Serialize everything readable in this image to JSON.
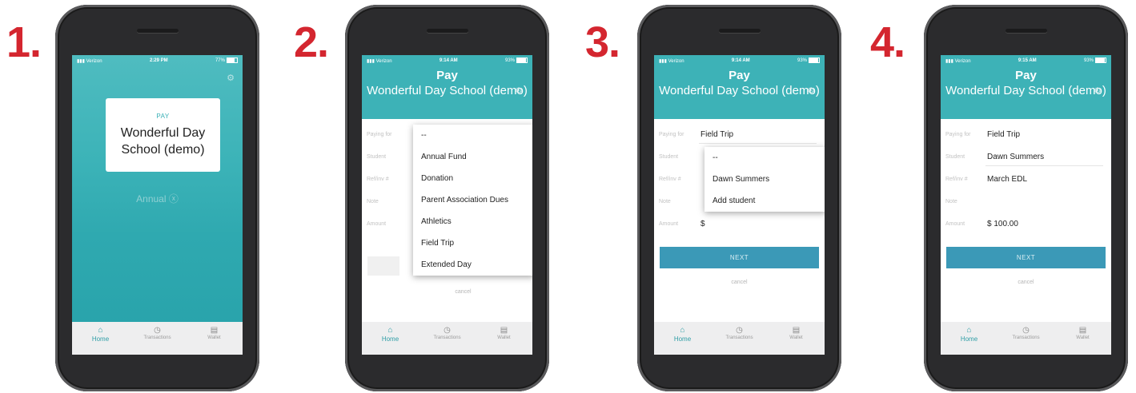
{
  "steps": [
    "1.",
    "2.",
    "3.",
    "4."
  ],
  "colors": {
    "step_number": "#d4262f",
    "teal": "#3db2b7",
    "button": "#3b99b7"
  },
  "status": {
    "s1": {
      "carrier": "Verizon",
      "time": "2:29 PM",
      "battery": "77%"
    },
    "s2": {
      "carrier": "Verizon",
      "time": "9:14 AM",
      "battery": "93%"
    },
    "s3": {
      "carrier": "Verizon",
      "time": "9:14 AM",
      "battery": "93%"
    },
    "s4": {
      "carrier": "Verizon",
      "time": "9:15 AM",
      "battery": "93%"
    }
  },
  "home": {
    "pay_label": "PAY",
    "school_name": "Wonderful Day School (demo)",
    "annual_link": "Annual ⓧ"
  },
  "header": {
    "title": "Pay",
    "school": "Wonderful Day School (demo)"
  },
  "form_labels": {
    "paying_for": "Paying for",
    "student": "Student",
    "ref": "Ref/inv #",
    "note": "Note",
    "amount": "Amount"
  },
  "screen2": {
    "paying_for_value": "--",
    "options": [
      "--",
      "Annual Fund",
      "Donation",
      "Parent Association Dues",
      "Athletics",
      "Field Trip",
      "Extended Day"
    ],
    "cancel": "cancel"
  },
  "screen3": {
    "paying_for_value": "Field Trip",
    "amount_prefix": "$",
    "student_options": [
      "--",
      "Dawn Summers",
      "Add student"
    ],
    "next": "NEXT",
    "cancel": "cancel"
  },
  "screen4": {
    "paying_for_value": "Field Trip",
    "student_value": "Dawn Summers",
    "ref_value": "March EDL",
    "amount_value": "$ 100.00",
    "next": "NEXT",
    "cancel": "cancel"
  },
  "tabs": {
    "home": "Home",
    "transactions": "Transactions",
    "wallet": "Wallet"
  },
  "icons": {
    "home": "home-icon",
    "transactions": "clock-icon",
    "wallet": "wallet-icon",
    "settings": "gear-icon"
  }
}
